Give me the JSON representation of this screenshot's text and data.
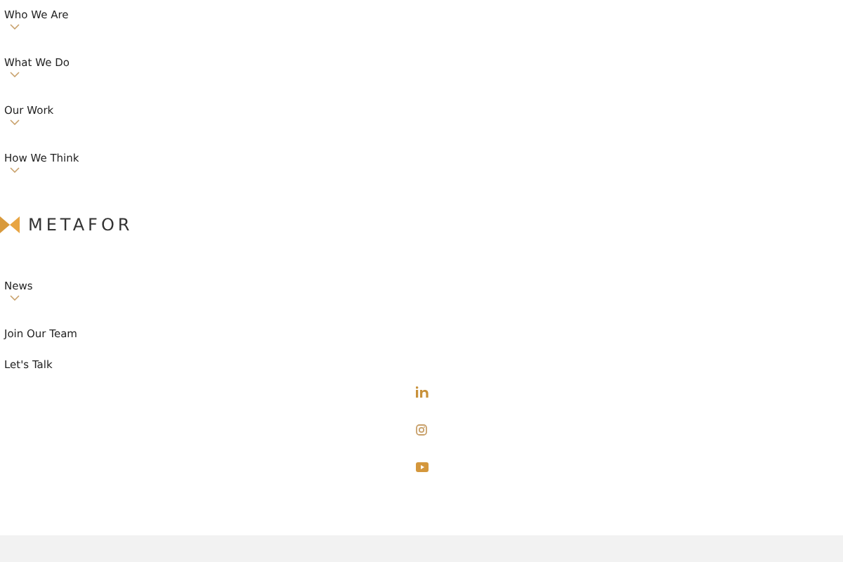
{
  "menu_top": [
    {
      "label": "Who We Are",
      "has_submenu": true
    },
    {
      "label": "What We Do",
      "has_submenu": true
    },
    {
      "label": "Our Work",
      "has_submenu": true
    },
    {
      "label": "How We Think",
      "has_submenu": true
    }
  ],
  "logo": {
    "text": "METAFOR"
  },
  "menu_bottom": [
    {
      "label": "News",
      "has_submenu": true
    },
    {
      "label": "Join Our Team",
      "has_submenu": false
    },
    {
      "label": "Let's Talk",
      "has_submenu": false
    }
  ],
  "social": [
    {
      "kind": "linkedin"
    },
    {
      "kind": "instagram"
    },
    {
      "kind": "youtube"
    }
  ]
}
